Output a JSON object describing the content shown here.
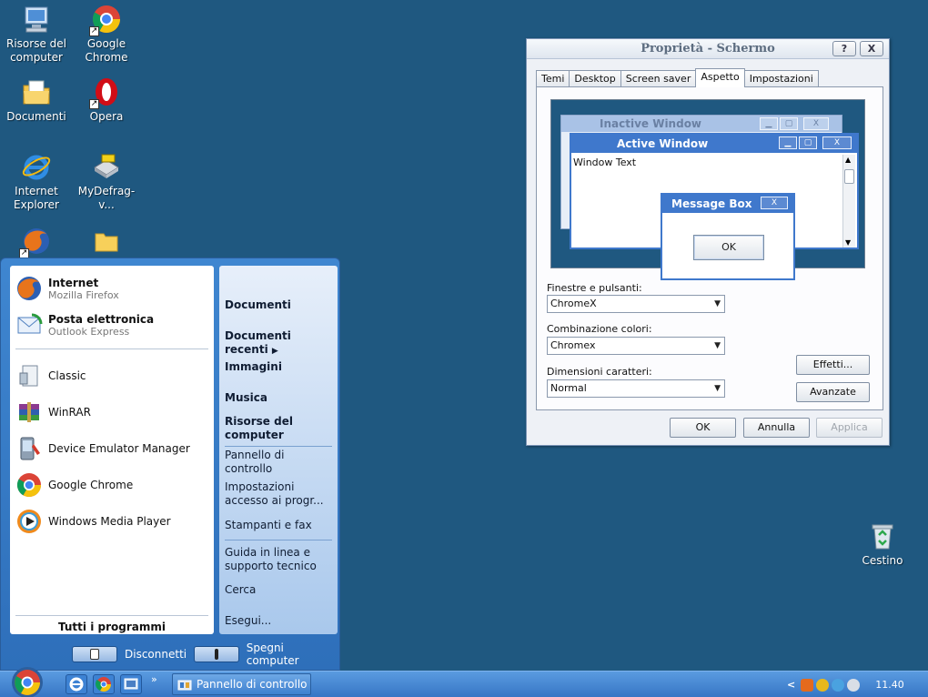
{
  "desktop": {
    "icons": [
      {
        "label": "Risorse del computer"
      },
      {
        "label": "Google Chrome"
      },
      {
        "label": "Documenti"
      },
      {
        "label": "Opera"
      },
      {
        "label": "Internet Explorer"
      },
      {
        "label": "MyDefrag-v..."
      },
      {
        "label": "Cestino"
      }
    ]
  },
  "dialog": {
    "title": "Proprietà - Schermo",
    "help_btn": "?",
    "close_btn": "X",
    "tabs": [
      "Temi",
      "Desktop",
      "Screen saver",
      "Aspetto",
      "Impostazioni"
    ],
    "preview": {
      "inactive_title": "Inactive Window",
      "active_title": "Active Window",
      "window_text": "Window Text",
      "msgbox_title": "Message Box",
      "msgbox_close": "X",
      "msgbox_ok": "OK",
      "btn_close": "X"
    },
    "windows_buttons_label": "Finestre e pulsanti:",
    "windows_buttons_value": "ChromeX",
    "color_scheme_label": "Combinazione colori:",
    "color_scheme_value": "Chromex",
    "font_size_label": "Dimensioni caratteri:",
    "font_size_value": "Normal",
    "effects_btn": "Effetti...",
    "advanced_btn": "Avanzate",
    "ok_btn": "OK",
    "cancel_btn": "Annulla",
    "apply_btn": "Applica"
  },
  "start_menu": {
    "pinned": [
      {
        "title": "Internet",
        "subtitle": "Mozilla Firefox"
      },
      {
        "title": "Posta elettronica",
        "subtitle": "Outlook Express"
      }
    ],
    "recent": [
      {
        "title": "Classic"
      },
      {
        "title": "WinRAR"
      },
      {
        "title": "Device Emulator Manager"
      },
      {
        "title": "Google Chrome"
      },
      {
        "title": "Windows Media Player"
      }
    ],
    "all_programs": "Tutti i programmi",
    "right": {
      "documents": "Documenti",
      "recent_docs": "Documenti recenti",
      "pictures": "Immagini",
      "music": "Musica",
      "my_computer": "Risorse del computer",
      "control_panel": "Pannello di controllo",
      "program_access": "Impostazioni accesso ai progr...",
      "printers": "Stampanti e fax",
      "help": "Guida in linea e supporto tecnico",
      "search": "Cerca",
      "run": "Esegui..."
    },
    "logoff": "Disconnetti",
    "shutdown": "Spegni computer"
  },
  "taskbar": {
    "overflow": "»",
    "task_label": "Pannello di controllo",
    "tray_arrow": "<",
    "clock": "11.40"
  },
  "colors": {
    "desktop": "#1f5880",
    "taskbar": "#3776c5",
    "active_title": "#3f78cc",
    "inactive_title": "#a9c2e6"
  }
}
